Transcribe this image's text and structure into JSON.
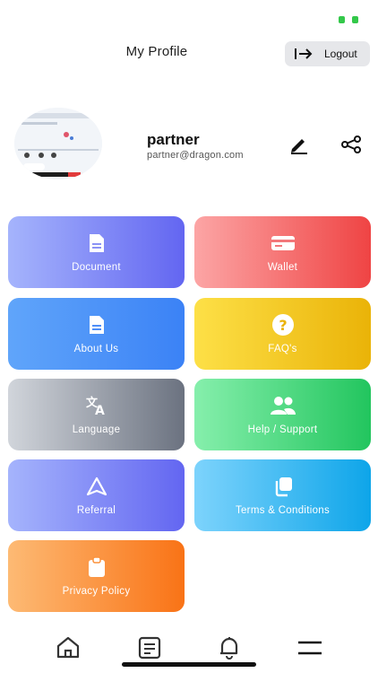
{
  "header": {
    "title": "My Profile",
    "logout_label": "Logout"
  },
  "profile": {
    "name": "partner",
    "email": "partner@dragon.com"
  },
  "tiles": [
    {
      "label": "Document",
      "icon": "document-icon"
    },
    {
      "label": "Wallet",
      "icon": "wallet-icon"
    },
    {
      "label": "About Us",
      "icon": "document-icon"
    },
    {
      "label": "FAQ's",
      "icon": "question-icon"
    },
    {
      "label": "Language",
      "icon": "translate-icon"
    },
    {
      "label": "Help / Support",
      "icon": "people-icon"
    },
    {
      "label": "Referral",
      "icon": "navigation-icon"
    },
    {
      "label": "Terms & Conditions",
      "icon": "copy-icon"
    },
    {
      "label": "Privacy Policy",
      "icon": "clipboard-icon"
    }
  ],
  "bottom_nav": [
    "home-icon",
    "notes-icon",
    "bell-icon",
    "menu-icon"
  ],
  "colors": {
    "document": [
      "#a5b4fc",
      "#6366f1"
    ],
    "wallet": [
      "#fca5a5",
      "#ef4444"
    ],
    "about": [
      "#60a5fa",
      "#3b82f6"
    ],
    "faq": [
      "#fde047",
      "#eab308"
    ],
    "language": [
      "#d1d5db",
      "#6b7280"
    ],
    "help": [
      "#86efac",
      "#22c55e"
    ],
    "referral": [
      "#a5b4fc",
      "#6366f1"
    ],
    "terms": [
      "#7dd3fc",
      "#0ea5e9"
    ],
    "privacy": [
      "#fdba74",
      "#f97316"
    ]
  }
}
